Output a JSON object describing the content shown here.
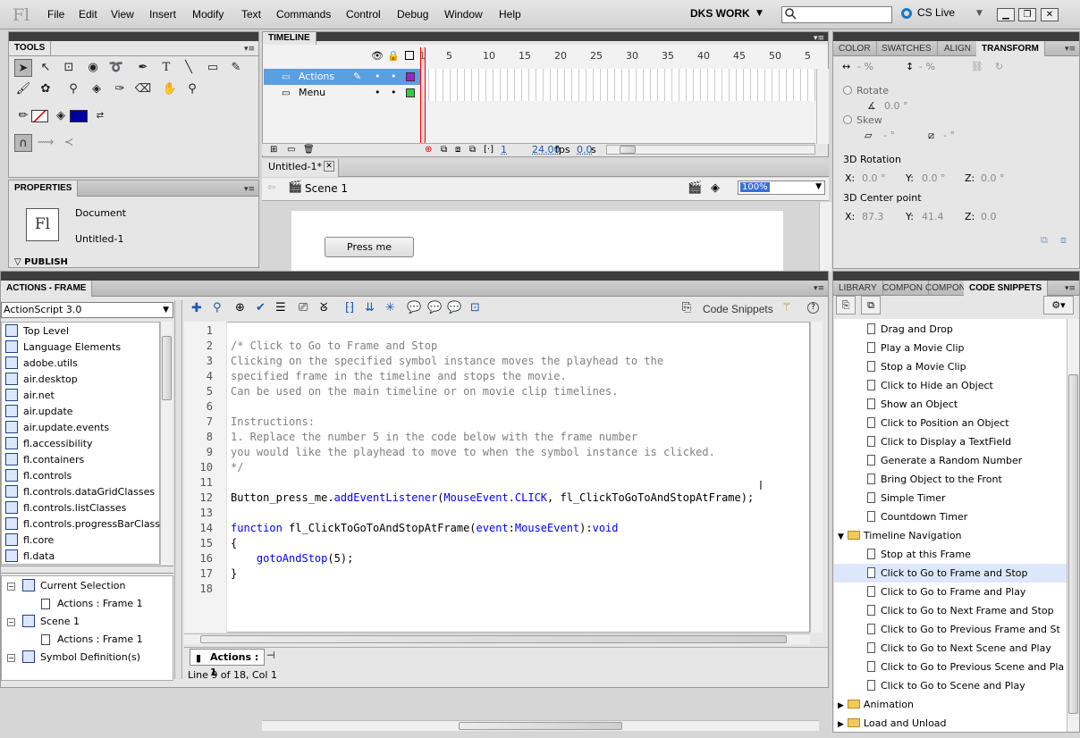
{
  "menubar": {
    "logo": "Fl",
    "items": [
      "File",
      "Edit",
      "View",
      "Insert",
      "Modify",
      "Text",
      "Commands",
      "Control",
      "Debug",
      "Window",
      "Help"
    ],
    "workspace": "DKS WORK",
    "search_placeholder": "",
    "cslive": "CS Live"
  },
  "tools": {
    "title": "TOOLS"
  },
  "properties": {
    "title": "PROPERTIES",
    "doc_icon": "Fl",
    "type": "Document",
    "name": "Untitled-1",
    "publish": "PUBLISH"
  },
  "timeline": {
    "title": "TIMELINE",
    "ruler": [
      "1",
      "5",
      "10",
      "15",
      "20",
      "25",
      "30",
      "35",
      "40",
      "45",
      "50",
      "5"
    ],
    "layers": [
      {
        "name": "Actions",
        "color": "#a020d0"
      },
      {
        "name": "Menu",
        "color": "#2ecc40"
      }
    ],
    "current_frame": "1",
    "fps": "24.00",
    "fps_unit": "fps",
    "time": "0.0",
    "time_unit": "s"
  },
  "document": {
    "tab": "Untitled-1*",
    "scene": "Scene 1",
    "zoom": "100%",
    "button_label": "Press me"
  },
  "right_panel": {
    "tabs": [
      "COLOR",
      "SWATCHES",
      "ALIGN",
      "TRANSFORM"
    ],
    "width_pct": "- %",
    "height_pct": "- %",
    "rotate_label": "Rotate",
    "rotate_value": "0.0 °",
    "skew_label": "Skew",
    "skew_h": "- °",
    "skew_v": "- °",
    "rotation3d_label": "3D Rotation",
    "rot": [
      {
        "axis": "X:",
        "value": "0.0 °"
      },
      {
        "axis": "Y:",
        "value": "0.0 °"
      },
      {
        "axis": "Z:",
        "value": "0.0 °"
      }
    ],
    "center3d_label": "3D Center point",
    "center": [
      {
        "axis": "X:",
        "value": "87.3"
      },
      {
        "axis": "Y:",
        "value": "41.4"
      },
      {
        "axis": "Z:",
        "value": "0.0"
      }
    ]
  },
  "actions": {
    "title": "ACTIONS - FRAME",
    "language": "ActionScript 3.0",
    "toolbox": [
      "Top Level",
      "Language Elements",
      "adobe.utils",
      "air.desktop",
      "air.net",
      "air.update",
      "air.update.events",
      "fl.accessibility",
      "fl.containers",
      "fl.controls",
      "fl.controls.dataGridClasses",
      "fl.controls.listClasses",
      "fl.controls.progressBarClasses",
      "fl.core",
      "fl.data"
    ],
    "nav_tree": [
      {
        "label": "Current Selection",
        "indent": 0
      },
      {
        "label": "Actions : Frame 1",
        "indent": 1
      },
      {
        "label": "Scene 1",
        "indent": 0
      },
      {
        "label": "Actions : Frame 1",
        "indent": 1
      },
      {
        "label": "Symbol Definition(s)",
        "indent": 0
      }
    ],
    "code_snippets_label": "Code Snippets",
    "code": [
      "",
      "/* Click to Go to Frame and Stop",
      "Clicking on the specified symbol instance moves the playhead to the",
      "specified frame in the timeline and stops the movie.",
      "Can be used on the main timeline or on movie clip timelines.",
      "",
      "Instructions:",
      "1. Replace the number 5 in the code below with the frame number",
      "you would like the playhead to move to when the symbol instance is clicked.",
      "*/",
      "",
      "Button_press_me.addEventListener(MouseEvent.CLICK, fl_ClickToGoToAndStopAtFrame);",
      "",
      "function fl_ClickToGoToAndStopAtFrame(event:MouseEvent):void",
      "{",
      "    gotoAndStop(5);",
      "}",
      ""
    ],
    "script_tab": "Actions : 1",
    "status": "Line 9 of 18, Col 1"
  },
  "library_panel": {
    "tabs": [
      "LIBRARY",
      "COMPON",
      "COMPON",
      "CODE SNIPPETS"
    ],
    "snippets": [
      {
        "label": "Drag and Drop",
        "type": "item"
      },
      {
        "label": "Play a Movie Clip",
        "type": "item"
      },
      {
        "label": "Stop a Movie Clip",
        "type": "item"
      },
      {
        "label": "Click to Hide an Object",
        "type": "item"
      },
      {
        "label": "Show an Object",
        "type": "item"
      },
      {
        "label": "Click to Position an Object",
        "type": "item"
      },
      {
        "label": "Click to Display a TextField",
        "type": "item"
      },
      {
        "label": "Generate a Random Number",
        "type": "item"
      },
      {
        "label": "Bring Object to the Front",
        "type": "item"
      },
      {
        "label": "Simple Timer",
        "type": "item"
      },
      {
        "label": "Countdown Timer",
        "type": "item"
      },
      {
        "label": "Timeline Navigation",
        "type": "folder-open"
      },
      {
        "label": "Stop at this Frame",
        "type": "item"
      },
      {
        "label": "Click to Go to Frame and Stop",
        "type": "item-selected"
      },
      {
        "label": "Click to Go to Frame and Play",
        "type": "item"
      },
      {
        "label": "Click to Go to Next Frame and Stop",
        "type": "item"
      },
      {
        "label": "Click to Go to Previous Frame and St",
        "type": "item"
      },
      {
        "label": "Click to Go to Next Scene and Play",
        "type": "item"
      },
      {
        "label": "Click to Go to Previous Scene and Pla",
        "type": "item"
      },
      {
        "label": "Click to Go to Scene and Play",
        "type": "item"
      },
      {
        "label": "Animation",
        "type": "folder"
      },
      {
        "label": "Load and Unload",
        "type": "folder"
      }
    ]
  }
}
